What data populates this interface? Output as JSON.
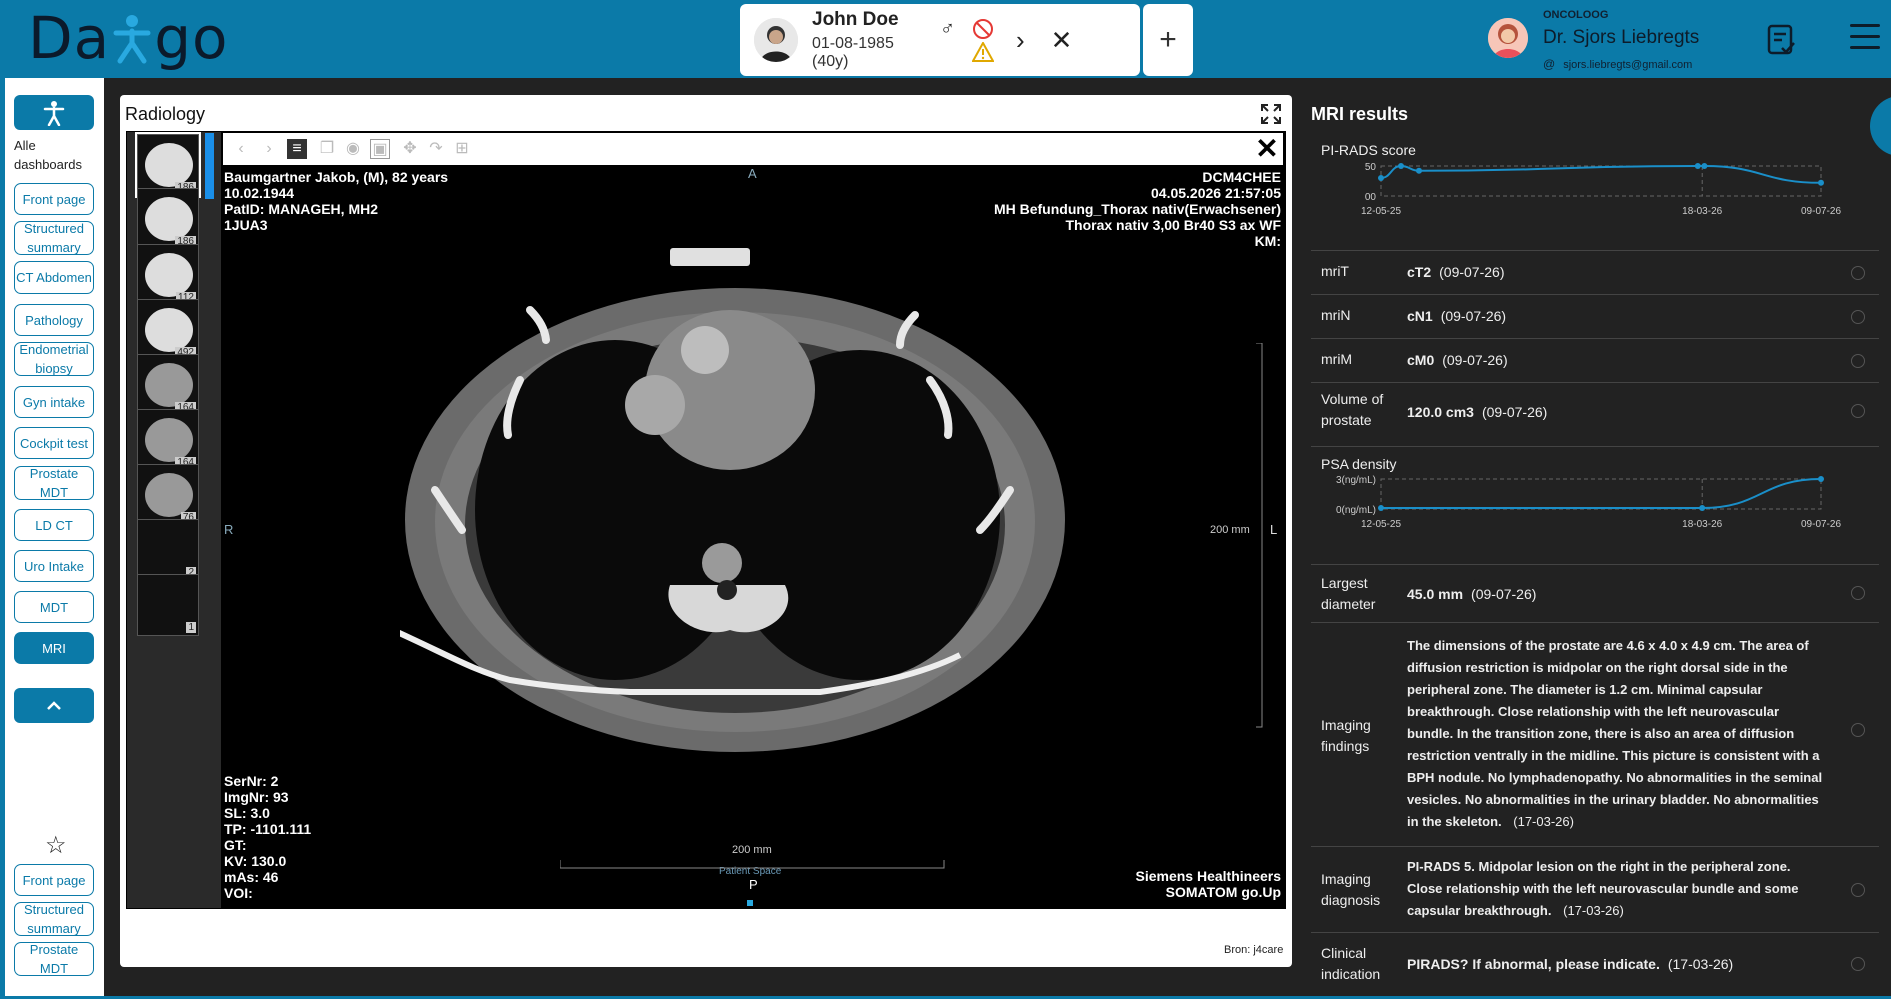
{
  "app": {
    "logo_left": "Da",
    "logo_right": "go"
  },
  "patient": {
    "name": "John Doe",
    "sex_symbol": "♂",
    "dob": "01-08-1985 (40y)",
    "next": "›",
    "close": "✕"
  },
  "add_tab": "+",
  "doctor": {
    "role": "ONCOLOOG",
    "name": "Dr. Sjors Liebregts",
    "email": "sjors.liebregts@gmail.com",
    "at": "@"
  },
  "sidebar": {
    "dashboards_label": "Alle\ndashboards",
    "items": [
      {
        "label": "Front page"
      },
      {
        "label": "Structured summary"
      },
      {
        "label": "CT Abdomen"
      },
      {
        "label": "Pathology"
      },
      {
        "label": "Endometrial biopsy"
      },
      {
        "label": "Gyn intake"
      },
      {
        "label": "Cockpit test"
      },
      {
        "label": "Prostate MDT"
      },
      {
        "label": "LD CT"
      },
      {
        "label": "Uro Intake"
      },
      {
        "label": "MDT"
      },
      {
        "label": "MRI"
      }
    ],
    "favorites": [
      {
        "label": "Front page"
      },
      {
        "label": "Structured summary"
      },
      {
        "label": "Prostate MDT"
      }
    ]
  },
  "radiology": {
    "title": "Radiology",
    "source": "Bron: j4care",
    "thumbnails": [
      {
        "count": "186"
      },
      {
        "count": "186"
      },
      {
        "count": "112"
      },
      {
        "count": "492"
      },
      {
        "count": "164"
      },
      {
        "count": "164"
      },
      {
        "count": "76"
      },
      {
        "count": "2"
      },
      {
        "count": "1"
      }
    ],
    "overlay": {
      "top_left": "Baumgartner Jakob, (M), 82 years\n10.02.1944\nPatID: MANAGEH, MH2\n1JUA3",
      "top_right": "DCM4CHEE\n04.05.2026 21:57:05\nMH Befundung_Thorax nativ(Erwachsener)\nThorax nativ 3,00 Br40 S3 ax WF\nKM:",
      "bottom_left": "SerNr: 2\nImgNr: 93\nSL: 3.0\nTP: -1101.111\nGT:\nKV: 130.0\nmAs: 46\nVOI:",
      "bottom_right": "Siemens Healthineers\nSOMATOM go.Up",
      "orient_top": "A",
      "orient_bottom": "P",
      "orient_left": "R",
      "orient_right": "L",
      "scale_right": "200 mm",
      "scale_bottom": "200 mm",
      "patient_space": "Patient Space"
    }
  },
  "mri": {
    "title": "MRI results",
    "pirads_chart_title": "PI-RADS score",
    "psa_chart_title": "PSA density",
    "rows": {
      "mriT": {
        "label": "mriT",
        "value": "cT2",
        "date": "(09-07-26)"
      },
      "mriN": {
        "label": "mriN",
        "value": "cN1",
        "date": "(09-07-26)"
      },
      "mriM": {
        "label": "mriM",
        "value": "cM0",
        "date": "(09-07-26)"
      },
      "volume": {
        "label": "Volume of prostate",
        "value": "120.0 cm3",
        "date": "(09-07-26)"
      },
      "diameter": {
        "label": "Largest diameter",
        "value": "45.0 mm",
        "date": "(09-07-26)"
      },
      "findings": {
        "label": "Imaging findings",
        "value": "The dimensions of the prostate are 4.6 x 4.0 x 4.9 cm. The area of diffusion restriction is midpolar on the right dorsal side in the peripheral zone. The diameter is 1.2 cm. Minimal capsular breakthrough. Close relationship with the left neurovascular bundle. In the transition zone, there is also an area of diffusion restriction ventrally in the midline. This picture is consistent with a BPH nodule. No lymphadenopathy. No abnormalities in the seminal vesicles. No abnormalities in the urinary bladder. No abnormalities in the skeleton.",
        "date": "(17-03-26)"
      },
      "diagnosis": {
        "label": "Imaging diagnosis",
        "value": "PI-RADS 5. Midpolar lesion on the right in the peripheral zone. Close relationship with the left neurovascular bundle and some capsular breakthrough.",
        "date": "(17-03-26)"
      },
      "indication": {
        "label": "Clinical indication",
        "value": "PIRADS? If abnormal, please indicate.",
        "date": "(17-03-26)"
      }
    }
  },
  "chart_data": [
    {
      "type": "line",
      "title": "PI-RADS score",
      "x_ticks": [
        "12-05-25",
        "18-03-26",
        "09-07-26"
      ],
      "y_ticks": [
        "50",
        "00"
      ],
      "series": [
        {
          "values": [
            30,
            50,
            42,
            50,
            50,
            22
          ]
        }
      ],
      "color": "#1a8fc9"
    },
    {
      "type": "line",
      "title": "PSA density",
      "x_ticks": [
        "12-05-25",
        "18-03-26",
        "09-07-26"
      ],
      "y_ticks": [
        "3(ng/mL)",
        "0(ng/mL)"
      ],
      "series": [
        {
          "values": [
            0.1,
            0.1,
            3
          ]
        }
      ],
      "color": "#1a8fc9"
    }
  ]
}
